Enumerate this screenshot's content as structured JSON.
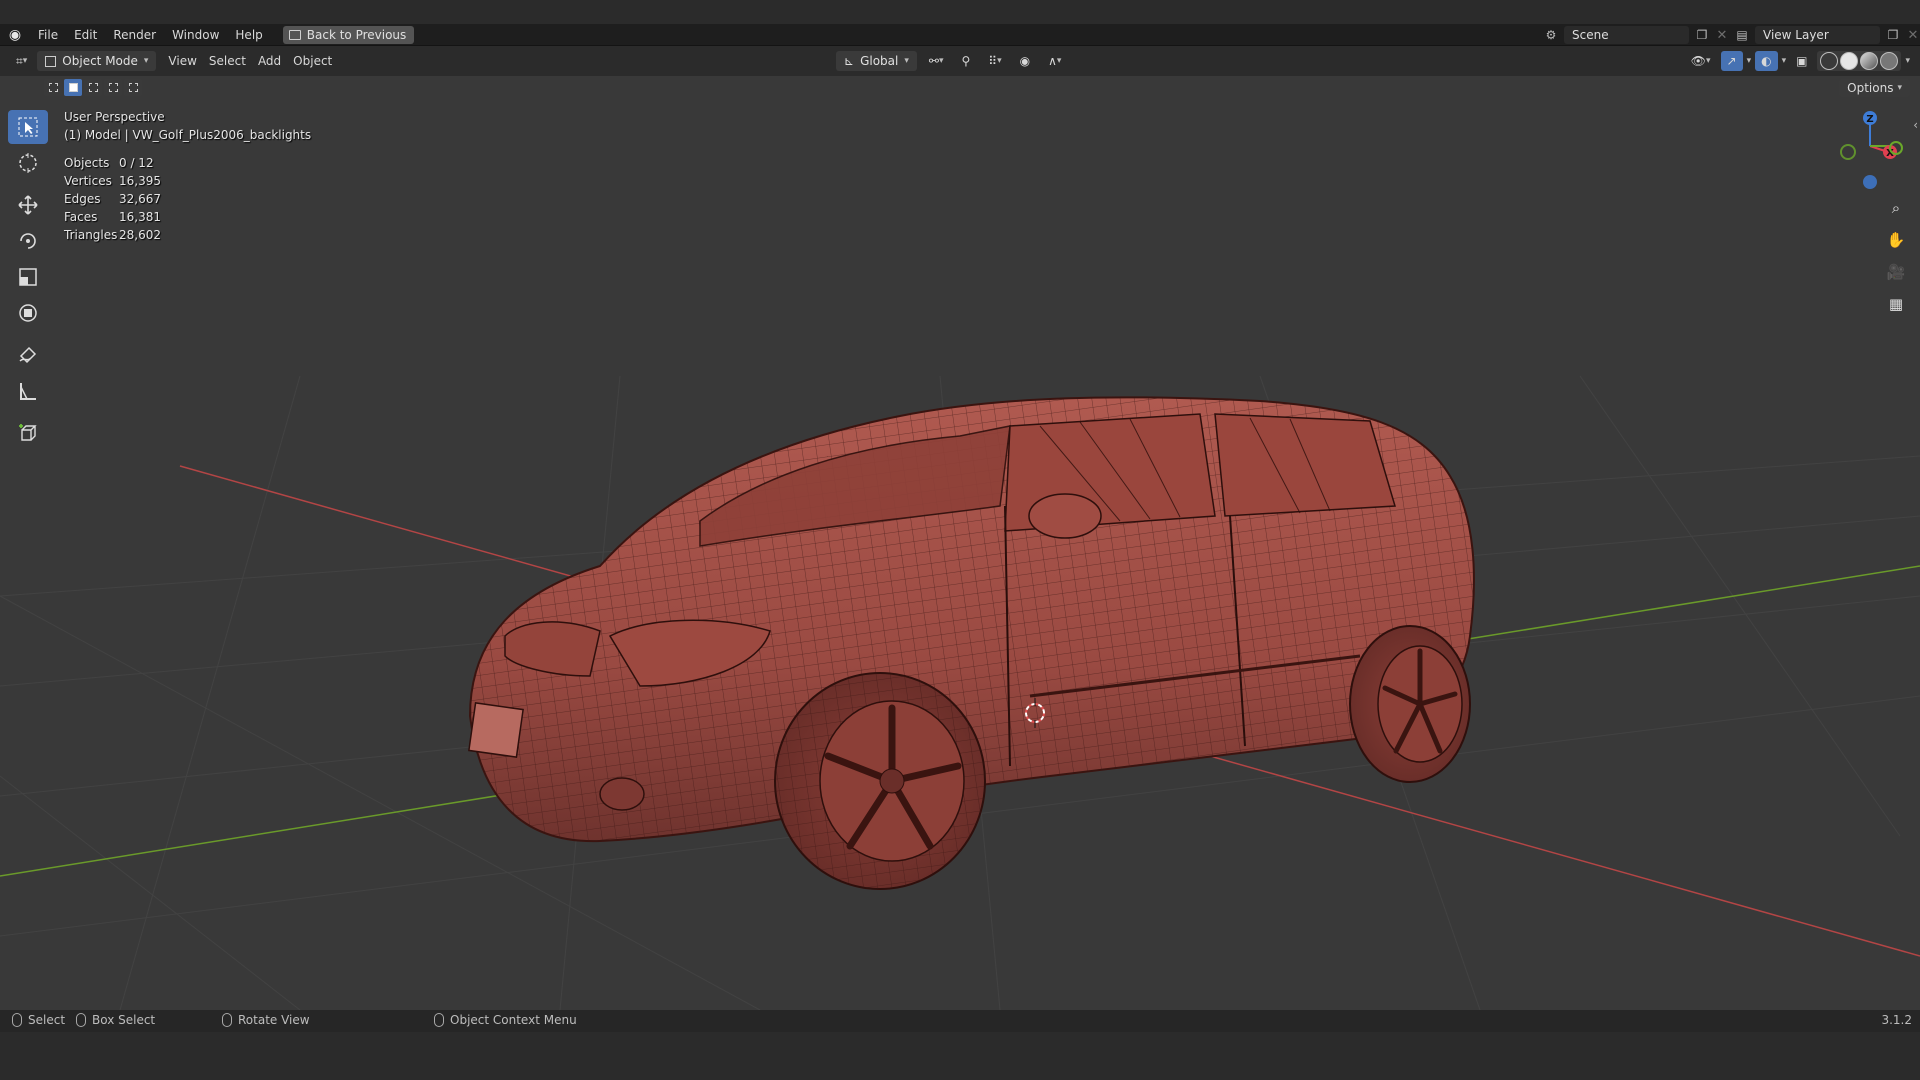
{
  "topbar": {
    "menus": [
      "File",
      "Edit",
      "Render",
      "Window",
      "Help"
    ],
    "back_label": "Back to Previous",
    "scene_label": "Scene",
    "view_layer_label": "View Layer"
  },
  "header": {
    "mode_label": "Object Mode",
    "menus": [
      "View",
      "Select",
      "Add",
      "Object"
    ],
    "transform_orientation": "Global"
  },
  "subheader": {
    "options_label": "Options"
  },
  "viewport": {
    "view_name": "User Perspective",
    "collection_info": "(1) Model | VW_Golf_Plus2006_backlights",
    "stats": [
      {
        "label": "Objects",
        "value": "0 / 12"
      },
      {
        "label": "Vertices",
        "value": "16,395"
      },
      {
        "label": "Edges",
        "value": "32,667"
      },
      {
        "label": "Faces",
        "value": "16,381"
      },
      {
        "label": "Triangles",
        "value": "28,602"
      }
    ]
  },
  "gizmo": {
    "z_label": "Z",
    "x_label": "X",
    "colors": {
      "x": "#e04050",
      "y": "#6aa82a",
      "z": "#3e7dd8"
    }
  },
  "statusbar": {
    "select": "Select",
    "box_select": "Box Select",
    "rotate_view": "Rotate View",
    "context_menu": "Object Context Menu",
    "version": "3.1.2"
  },
  "colors": {
    "accent": "#4772b3",
    "mesh": "#a8524a",
    "x_axis": "#b34545",
    "y_axis": "#6a9a2a"
  }
}
